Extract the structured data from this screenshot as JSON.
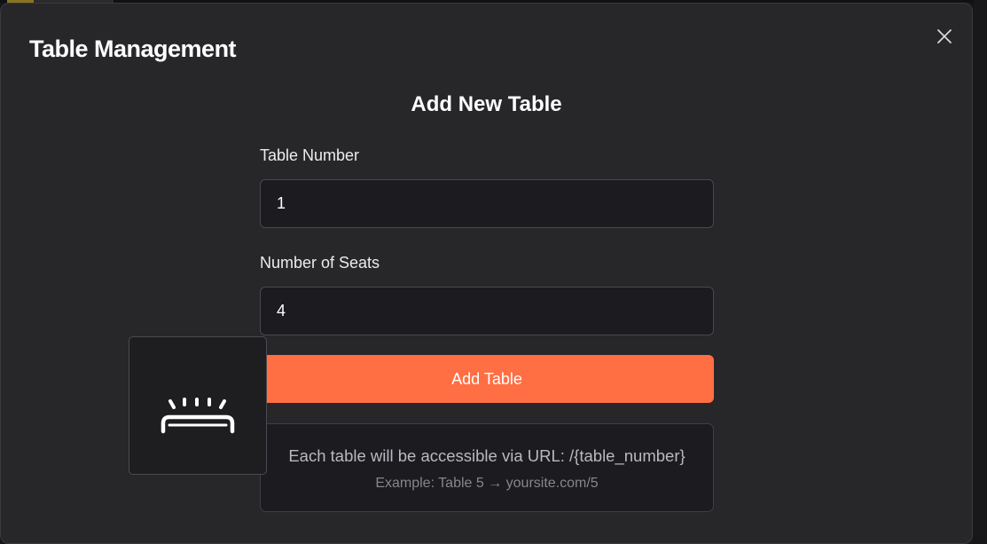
{
  "modal": {
    "title": "Table Management",
    "section_title": "Add New Table"
  },
  "form": {
    "table_number_label": "Table Number",
    "table_number_value": "1",
    "seats_label": "Number of Seats",
    "seats_value": "4",
    "submit_label": "Add Table"
  },
  "info": {
    "main_text": "Each table will be accessible via URL: /{table_number}",
    "example_text": "Example: Table 5 → yoursite.com/5"
  },
  "icons": {
    "close": "close-icon",
    "dragged": "service-bell-icon"
  },
  "colors": {
    "accent": "#ff6f43",
    "modal_bg": "#27272a",
    "input_bg": "#1c1b20"
  }
}
